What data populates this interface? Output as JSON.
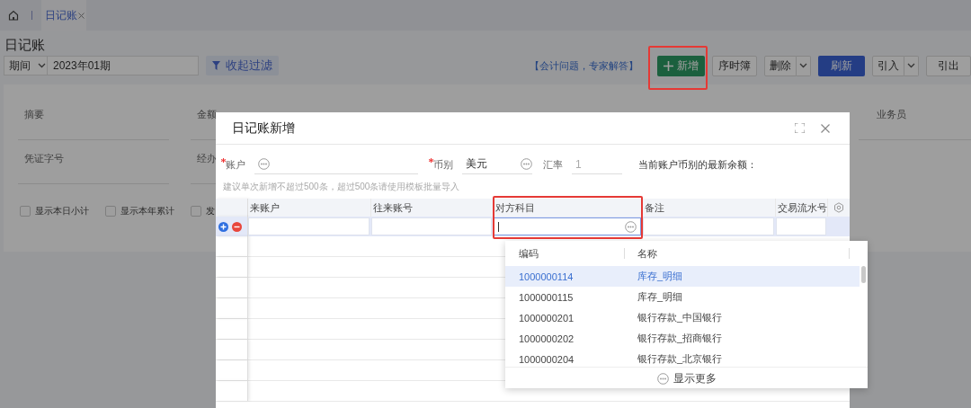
{
  "tabs": [
    {
      "label": "日记账",
      "selected": true
    }
  ],
  "page_title": "日记账",
  "filter_bar": {
    "period_select": "期间",
    "period_value": "2023年01期",
    "collapse_button": "收起过滤"
  },
  "toolbar": {
    "help_link": "【会计问题，专家解答】",
    "buttons": [
      {
        "label": "新增",
        "kind": "add",
        "highlighted": true
      },
      {
        "label": "序时簿",
        "kind": "plain"
      },
      {
        "label": "删除",
        "kind": "split"
      },
      {
        "label": "刷新",
        "kind": "primary"
      },
      {
        "label": "引入",
        "kind": "split"
      },
      {
        "label": "引出",
        "kind": "plain"
      }
    ]
  },
  "filter_fields": [
    {
      "label": "摘要"
    },
    {
      "label": "金额"
    },
    {
      "label": "业务员"
    },
    {
      "label": "凭证字号"
    },
    {
      "label": "经办"
    }
  ],
  "filter_checks": [
    {
      "label": "显示本日小计",
      "checked": false
    },
    {
      "label": "显示本年累计",
      "checked": false
    },
    {
      "label": "发",
      "checked": false
    }
  ],
  "dialog": {
    "title": "日记账新增",
    "fields": [
      {
        "label": "账户",
        "required": true,
        "kind": "lookup"
      },
      {
        "label": "币别",
        "required": true,
        "value": "美元",
        "kind": "lookup"
      },
      {
        "label": "汇率",
        "required": false,
        "value": "1",
        "kind": "text"
      }
    ],
    "balance_label": "当前账户币别的最新余额：",
    "hint": "建议单次新增不超过500条，超过500条请使用模板批量导入",
    "columns": [
      {
        "label": "来账户",
        "highlighted": false
      },
      {
        "label": "往来账号",
        "highlighted": false
      },
      {
        "label": "对方科目",
        "highlighted": true
      },
      {
        "label": "备注",
        "highlighted": false
      },
      {
        "label": "交易流水号",
        "highlighted": false
      }
    ],
    "dropdown": {
      "columns": [
        "编码",
        "名称"
      ],
      "rows": [
        {
          "code": "1000000114",
          "name": "库存_明细",
          "selected": true
        },
        {
          "code": "1000000115",
          "name": "库存_明细",
          "selected": false
        },
        {
          "code": "1000000201",
          "name": "银行存款_中国银行",
          "selected": false
        },
        {
          "code": "1000000202",
          "name": "银行存款_招商银行",
          "selected": false
        },
        {
          "code": "1000000204",
          "name": "银行存款_北京银行",
          "selected": false
        }
      ],
      "more_button": "显示更多"
    }
  }
}
